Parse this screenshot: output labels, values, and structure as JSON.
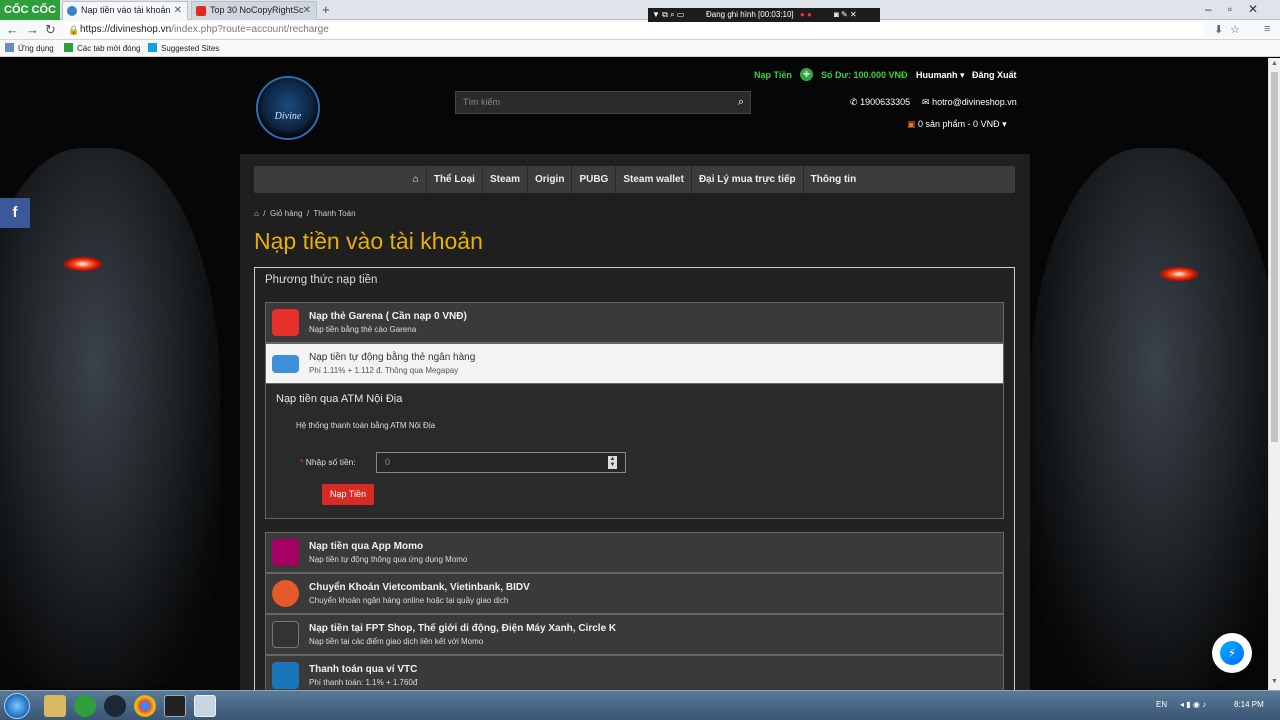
{
  "browser": {
    "brand": "CỐC CỐC",
    "tabs": [
      {
        "title": "Nạp tiền vào tài khoản",
        "active": true
      },
      {
        "title": "Top 30 NoCopyRightSc",
        "active": false
      }
    ],
    "url_host": "https://divineshop.vn",
    "url_path": "/index.php?route=account/recharge",
    "bookmarks": [
      "Ứng dụng",
      "Các tab mới đóng",
      "Suggested Sites"
    ]
  },
  "recorder": {
    "label": "Đang ghi hình [00:03:10]"
  },
  "header": {
    "logo_text": "Divine",
    "search_placeholder": "Tìm kiếm",
    "topup_link": "Nạp Tiền",
    "balance": "Số Dư: 100.000 VNĐ",
    "username": "Huumanh",
    "logout": "Đăng Xuất",
    "phone": "1900633305",
    "email": "hotro@divineshop.vn",
    "cart": "0 sản phẩm - 0 VNĐ"
  },
  "menu": [
    "Thể Loại",
    "Steam",
    "Origin",
    "PUBG",
    "Steam wallet",
    "Đại Lý mua trực tiếp",
    "Thông tin"
  ],
  "breadcrumb": [
    "Giỏ hàng",
    "Thanh Toán"
  ],
  "page_title": "Nạp tiền vào tài khoản",
  "panel": {
    "heading": "Phương thức nạp tiền",
    "methods_top": [
      {
        "name": "Nạp thẻ Garena ( Cần nạp 0 VNĐ)",
        "desc": "Nạp tiền bằng thẻ cào Garena",
        "icon": "garena-icon",
        "color": "#e8302a"
      },
      {
        "name": "Nạp tiền tự động bằng thẻ ngân hàng",
        "desc": "Phí 1.11% + 1.112 đ. Thông qua Megapay",
        "icon": "atm-card-icon",
        "color": "#3f8fd8"
      }
    ],
    "atm": {
      "title": "Nạp tiền qua ATM Nội Địa",
      "desc": "Hệ thống thanh toán bằng ATM Nội Địa",
      "amount_label": "Nhập số tiền:",
      "amount_value": "0",
      "button": "Nạp Tiền"
    },
    "methods_bottom": [
      {
        "name": "Nạp tiền qua App Momo",
        "desc": "Nạp tiền tự động thông qua ứng dụng Momo",
        "icon": "momo-icon",
        "color": "#a50064"
      },
      {
        "name": "Chuyển Khoản Vietcombank, Vietinbank, BIDV",
        "desc": "Chuyển khoản ngân hàng online hoặc tại quầy giao dịch",
        "icon": "bank-transfer-icon",
        "color": "#e45a2a"
      },
      {
        "name": "Nạp tiền tại FPT Shop, Thế giới di động, Điện Máy Xanh, Circle K",
        "desc": "Nạp tiền tại các điểm giao dịch liên kết với Momo",
        "icon": "fpt-shop-icon",
        "color": "#333333"
      },
      {
        "name": "Thanh toán qua ví VTC",
        "desc": "Phí thanh toán: 1.1% + 1.760đ",
        "icon": "vtc-wallet-icon",
        "color": "#1b75bb"
      }
    ]
  },
  "taskbar": {
    "lang": "EN",
    "time": "8:14 PM"
  }
}
